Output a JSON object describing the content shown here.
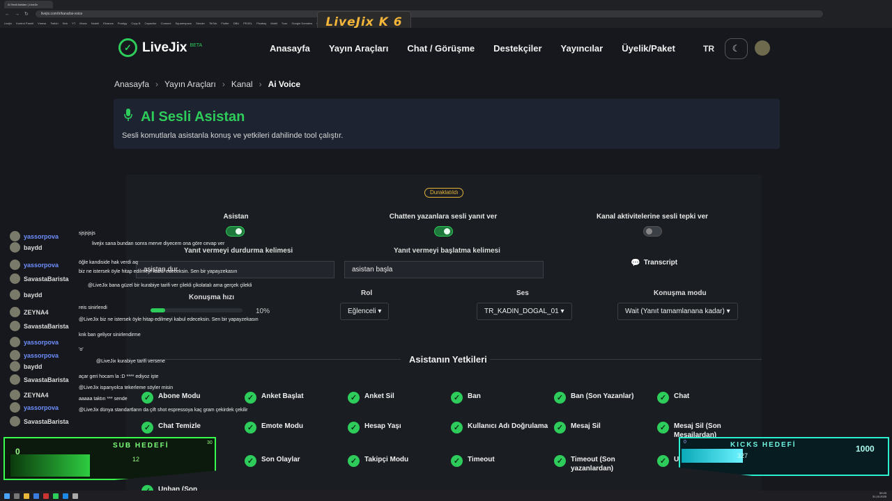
{
  "browser": {
    "tab_title": "AI Sesli Asistan | LiveJix",
    "url": "livejix.com/tr/kanal/ai-voice",
    "bookmarks": [
      "Livejix",
      "Kontrol Paneli",
      "Vmess",
      "Twitch",
      "Kick",
      "YT",
      "Music",
      "Nodeli",
      "Ekranos",
      "Prodigy",
      "Copy B",
      "Capacitor",
      "Connect",
      "Squarespace",
      "Sender",
      "TikTok",
      "Flutter",
      "DBU",
      "PEXEL",
      "Pixabay",
      "Mobil",
      "Tuzz",
      "Google Domains",
      "Google Ürünleri",
      "Shopier",
      "Tüm Yer İşaretleri"
    ]
  },
  "overlay_title": "LiveJix K 6",
  "header": {
    "brand": "LiveJix",
    "brand_badge": "BETA",
    "nav": [
      "Anasayfa",
      "Yayın Araçları",
      "Chat / Görüşme",
      "Destekçiler",
      "Yayıncılar",
      "Üyelik/Paket"
    ],
    "lang": "TR"
  },
  "breadcrumb": [
    "Anasayfa",
    "Yayın Araçları",
    "Kanal",
    "Ai Voice"
  ],
  "hero": {
    "title": "AI Sesli Asistan",
    "subtitle": "Sesli komutlarla asistanla konuş ve yetkileri dahilinde tool çalıştır."
  },
  "panel": {
    "status": "Duraklatıldı",
    "toggles": [
      {
        "label": "Asistan",
        "on": true
      },
      {
        "label": "Chatten yazanlara sesli yanıt ver",
        "on": true
      },
      {
        "label": "Kanal aktivitelerine sesli tepki ver",
        "on": false
      }
    ],
    "stop_word_label": "Yanıt vermeyi durdurma kelimesi",
    "stop_word_value": "asistan dur",
    "start_word_label": "Yanıt vermeyi başlatma kelimesi",
    "start_word_value": "asistan başla",
    "transcript_label": "Transcript",
    "speed_label": "Konuşma hızı",
    "speed_value": "10%",
    "speed_fraction": 0.1,
    "role_label": "Rol",
    "role_value": "Eğlenceli",
    "voice_label": "Ses",
    "voice_value": "TR_KADIN_DOGAL_01",
    "mode_label": "Konuşma modu",
    "mode_value": "Wait (Yanıt tamamlanana kadar)",
    "permissions_title": "Asistanın Yetkileri",
    "permissions": [
      "Abone Modu",
      "Anket Başlat",
      "Anket Sil",
      "Ban",
      "Ban (Son Yazanlar)",
      "Chat",
      "Chat Temizle",
      "Emote Modu",
      "Hesap Yaşı",
      "Kullanıcı Adı Doğrulama",
      "Mesaj Sil",
      "Mesaj Sil (Son Mesajlardan)",
      "",
      "Son Olaylar",
      "Takipçi Modu",
      "Timeout",
      "Timeout (Son yazanlardan)",
      "Unban",
      "Unban (Son"
    ]
  },
  "chat": {
    "users": [
      "yassorpova",
      "baydd",
      "yassorpova",
      "SavastaBarista",
      "baydd",
      "ZEYNA4",
      "SavastaBarista",
      "yassorpova",
      "yassorpova",
      "baydd",
      "SavastaBarista",
      "ZEYNA4",
      "yassorpova",
      "SavastaBarista"
    ],
    "messages": [
      "sjsjsjsjs",
      "livejix sana bundan sonra merve diyecem ona göre cevap ver",
      "öğle kandiside hak verdi aq",
      "biz ne istersek öyle hitap edilmeyi kabul edeceksin. Sen bir yapayzekasın",
      "@LiveJix bana güzel bir kurabiye tarifi ver çilekli çikolatalı ama gerçek çilekli",
      "reis sinirlendi",
      "@LiveJix biz ne istersek öyle hitap edilmeyi kabul edeceksin. Sen bir yapayzekasın",
      "knk ban geliyor sinirlendirme",
      "'o'",
      "@LiveJix kurabiye tarifi versene",
      "açar geri hocam la :D **** ediyoz işte",
      "@LiveJix ispanyolca tekerleme söyler misin",
      "aaaaa taktın *** sende",
      "@LiveJix dünya standartların da çift shot espressoya kaç gram çekirdek çekilir"
    ]
  },
  "sub_goal": {
    "label": "SUB HEDEFİ",
    "start": "0",
    "target": "30",
    "current": "12",
    "fraction": 0.4
  },
  "kick_goal": {
    "label": "KICKS HEDEFİ",
    "start": "0",
    "target": "1000",
    "current": "327",
    "fraction": 0.327
  },
  "taskbar": {
    "time": "00:23",
    "date": "31.10.2025"
  },
  "colors": {
    "accent": "#2ecc5a",
    "status": "#e5b53a",
    "sub": "#39ff4d",
    "kicks": "#2af0d0"
  }
}
